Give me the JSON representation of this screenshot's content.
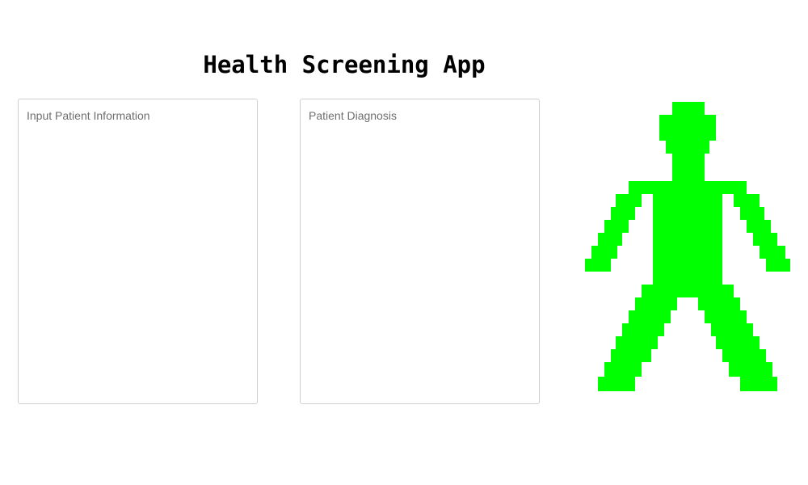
{
  "app": {
    "title": "Health Screening App"
  },
  "input_panel": {
    "placeholder": "Input Patient Information",
    "value": ""
  },
  "diagnosis_panel": {
    "placeholder": "Patient Diagnosis",
    "value": ""
  },
  "figure": {
    "icon": "human-body-figure-icon",
    "color": "#00ff00"
  }
}
